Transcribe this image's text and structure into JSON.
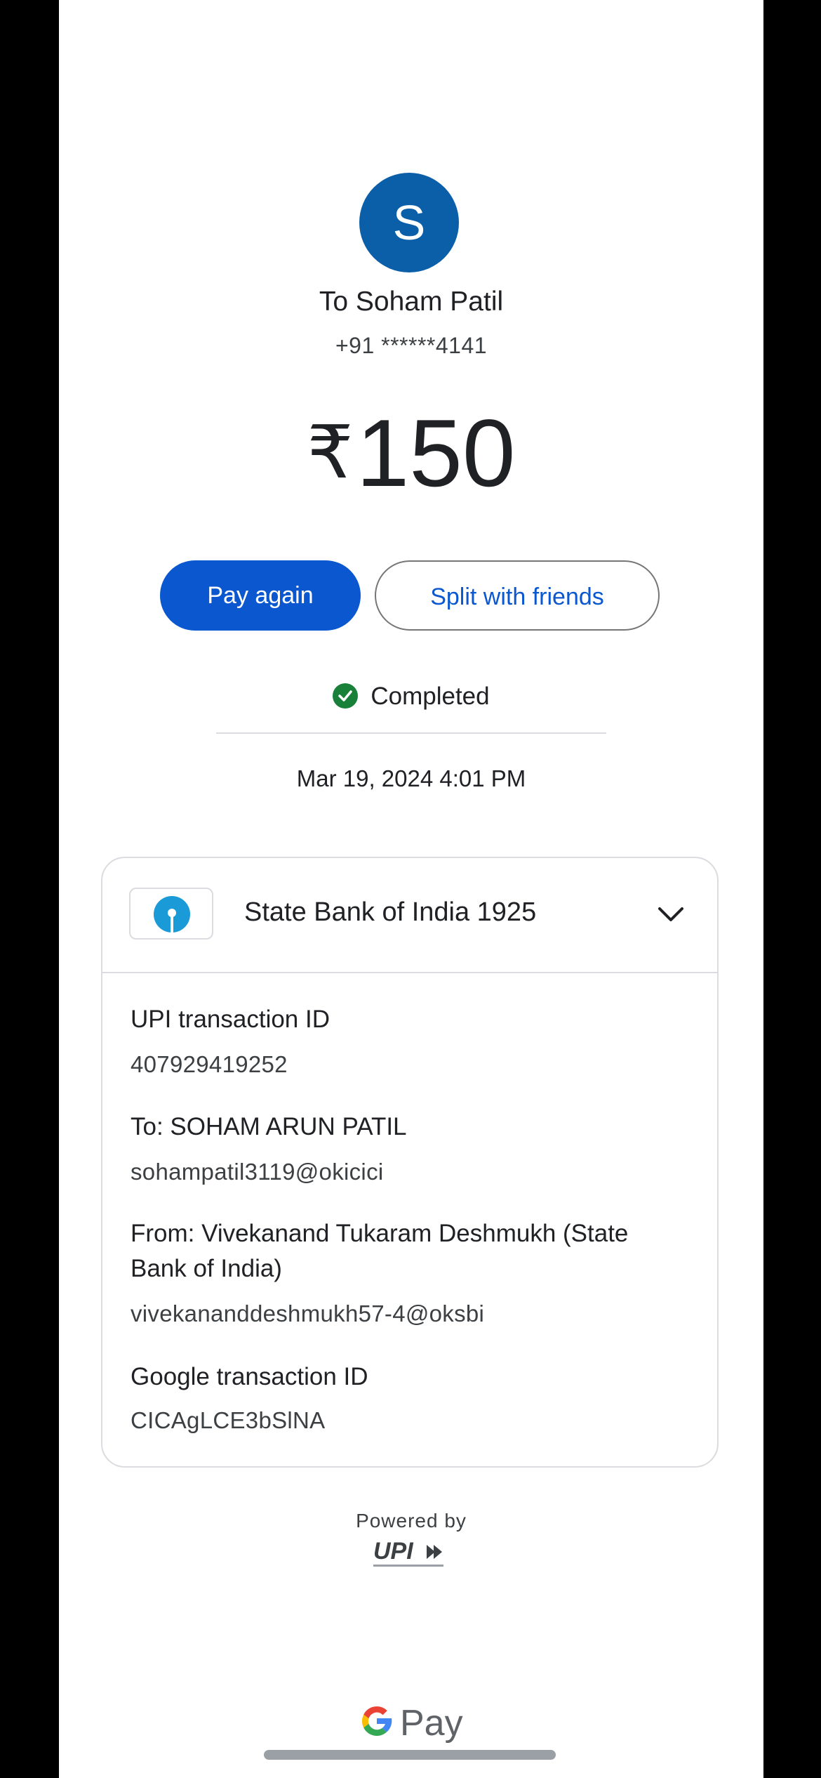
{
  "recipient": {
    "avatar_initial": "S",
    "name": "To Soham Patil",
    "phone": "+91 ******4141"
  },
  "payment": {
    "currency_symbol": "₹",
    "amount": "150",
    "status": "Completed",
    "datetime": "Mar 19, 2024 4:01 PM"
  },
  "actions": {
    "pay_again": "Pay again",
    "split": "Split with friends"
  },
  "card": {
    "bank_name": "State Bank of India 1925",
    "details": [
      {
        "label": "UPI transaction ID",
        "value": "407929419252"
      },
      {
        "label": "To: SOHAM ARUN PATIL",
        "value": "sohampatil3119@okicici"
      },
      {
        "label": "From: Vivekanand Tukaram Deshmukh (State Bank of India)",
        "value": "vivekananddeshmukh57-4@oksbi"
      },
      {
        "label": "Google transaction ID",
        "value": "CICAgLCE3bSlNA"
      }
    ]
  },
  "footer": {
    "powered_by": "Powered by",
    "upi_text": "UPI",
    "brand_text": "Pay"
  },
  "colors": {
    "avatar": "#0b5fa9",
    "primary_button": "#0b57d0",
    "success": "#188038"
  }
}
